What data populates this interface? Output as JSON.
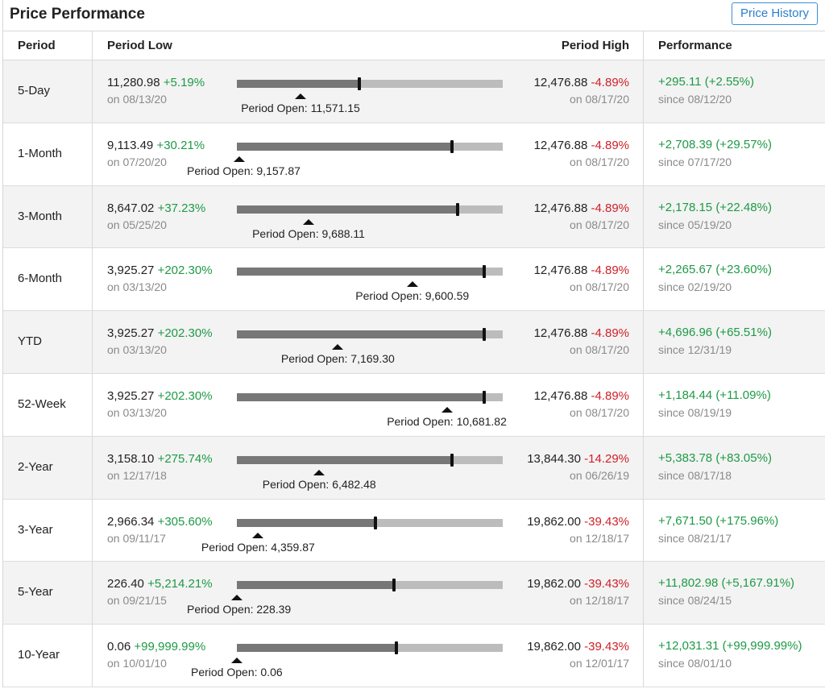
{
  "header": {
    "title": "Price Performance",
    "price_history_button": "Price History"
  },
  "columns": {
    "period": "Period",
    "low": "Period Low",
    "high": "Period High",
    "performance": "Performance"
  },
  "open_prefix": "Period Open: ",
  "rows": [
    {
      "period": "5-Day",
      "low": "11,280.98",
      "low_pct": "+5.19%",
      "low_date": "on 08/13/20",
      "high": "12,476.88",
      "high_pct": "-4.89%",
      "high_date": "on 08/17/20",
      "open": "11,571.15",
      "perf": "+295.11 (+2.55%)",
      "perf_date": "since 08/12/20",
      "current_fraction": 0.46,
      "open_fraction": 0.24
    },
    {
      "period": "1-Month",
      "low": "9,113.49",
      "low_pct": "+30.21%",
      "low_date": "on 07/20/20",
      "high": "12,476.88",
      "high_pct": "-4.89%",
      "high_date": "on 08/17/20",
      "open": "9,157.87",
      "perf": "+2,708.39 (+29.57%)",
      "perf_date": "since 07/17/20",
      "current_fraction": 0.81,
      "open_fraction": 0.01
    },
    {
      "period": "3-Month",
      "low": "8,647.02",
      "low_pct": "+37.23%",
      "low_date": "on 05/25/20",
      "high": "12,476.88",
      "high_pct": "-4.89%",
      "high_date": "on 08/17/20",
      "open": "9,688.11",
      "perf": "+2,178.15 (+22.48%)",
      "perf_date": "since 05/19/20",
      "current_fraction": 0.83,
      "open_fraction": 0.27
    },
    {
      "period": "6-Month",
      "low": "3,925.27",
      "low_pct": "+202.30%",
      "low_date": "on 03/13/20",
      "high": "12,476.88",
      "high_pct": "-4.89%",
      "high_date": "on 08/17/20",
      "open": "9,600.59",
      "perf": "+2,265.67 (+23.60%)",
      "perf_date": "since 02/19/20",
      "current_fraction": 0.93,
      "open_fraction": 0.66
    },
    {
      "period": "YTD",
      "low": "3,925.27",
      "low_pct": "+202.30%",
      "low_date": "on 03/13/20",
      "high": "12,476.88",
      "high_pct": "-4.89%",
      "high_date": "on 08/17/20",
      "open": "7,169.30",
      "perf": "+4,696.96 (+65.51%)",
      "perf_date": "since 12/31/19",
      "current_fraction": 0.93,
      "open_fraction": 0.38
    },
    {
      "period": "52-Week",
      "low": "3,925.27",
      "low_pct": "+202.30%",
      "low_date": "on 03/13/20",
      "high": "12,476.88",
      "high_pct": "-4.89%",
      "high_date": "on 08/17/20",
      "open": "10,681.82",
      "perf": "+1,184.44 (+11.09%)",
      "perf_date": "since 08/19/19",
      "current_fraction": 0.93,
      "open_fraction": 0.79
    },
    {
      "period": "2-Year",
      "low": "3,158.10",
      "low_pct": "+275.74%",
      "low_date": "on 12/17/18",
      "high": "13,844.30",
      "high_pct": "-14.29%",
      "high_date": "on 06/26/19",
      "open": "6,482.48",
      "perf": "+5,383.78 (+83.05%)",
      "perf_date": "since 08/17/18",
      "current_fraction": 0.81,
      "open_fraction": 0.31
    },
    {
      "period": "3-Year",
      "low": "2,966.34",
      "low_pct": "+305.60%",
      "low_date": "on 09/11/17",
      "high": "19,862.00",
      "high_pct": "-39.43%",
      "high_date": "on 12/18/17",
      "open": "4,359.87",
      "perf": "+7,671.50 (+175.96%)",
      "perf_date": "since 08/21/17",
      "current_fraction": 0.52,
      "open_fraction": 0.08
    },
    {
      "period": "5-Year",
      "low": "226.40",
      "low_pct": "+5,214.21%",
      "low_date": "on 09/21/15",
      "high": "19,862.00",
      "high_pct": "-39.43%",
      "high_date": "on 12/18/17",
      "open": "228.39",
      "perf": "+11,802.98 (+5,167.91%)",
      "perf_date": "since 08/24/15",
      "current_fraction": 0.59,
      "open_fraction": 0.0
    },
    {
      "period": "10-Year",
      "low": "0.06",
      "low_pct": "+99,999.99%",
      "low_date": "on 10/01/10",
      "high": "19,862.00",
      "high_pct": "-39.43%",
      "high_date": "on 12/01/17",
      "open": "0.06",
      "perf": "+12,031.31 (+99,999.99%)",
      "perf_date": "since 08/01/10",
      "current_fraction": 0.6,
      "open_fraction": 0.0
    }
  ],
  "colors": {
    "positive": "#1e9a46",
    "negative": "#d0202a",
    "accent": "#2a7fcf"
  }
}
